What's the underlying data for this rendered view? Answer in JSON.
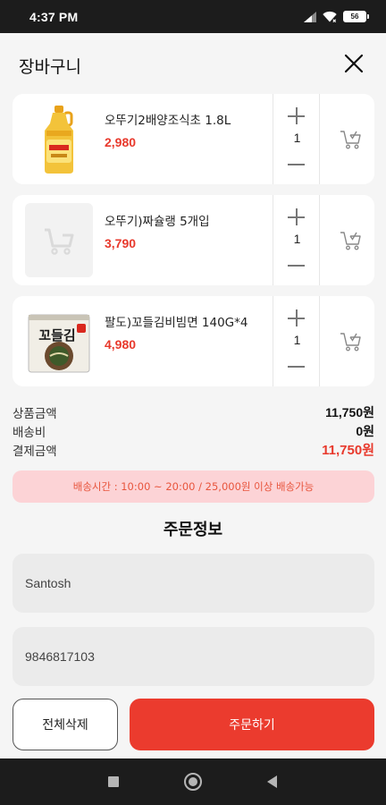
{
  "status_bar": {
    "time": "4:37 PM",
    "battery": "56"
  },
  "header": {
    "title": "장바구니"
  },
  "cart": {
    "items": [
      {
        "name": "오뚜기2배양조식초 1.8L",
        "price": "2,980",
        "quantity": "1",
        "thumbnail": "vinegar-bottle-image"
      },
      {
        "name": "오뚜기)짜슐랭 5개입",
        "price": "3,790",
        "quantity": "1",
        "thumbnail": "placeholder-cart-image"
      },
      {
        "name": "팔도)꼬들김비빔면 140G*4",
        "price": "4,980",
        "quantity": "1",
        "thumbnail": "noodle-package-image",
        "package_text": "꼬들김"
      }
    ]
  },
  "summary": {
    "subtotal_label": "상품금액",
    "subtotal_value": "11,750원",
    "shipping_label": "배송비",
    "shipping_value": "0원",
    "total_label": "결제금액",
    "total_value": "11,750원"
  },
  "delivery_notice": "배송시간 : 10:00 ~ 20:00 / 25,000원 이상 배송가능",
  "order_info": {
    "title": "주문정보",
    "name_value": "Santosh",
    "phone_value": "9846817103"
  },
  "buttons": {
    "delete_all": "전체삭제",
    "order": "주문하기"
  },
  "colors": {
    "accent": "#eb3b2e",
    "notice_bg": "#fcd3d6",
    "price": "#e8392c"
  }
}
